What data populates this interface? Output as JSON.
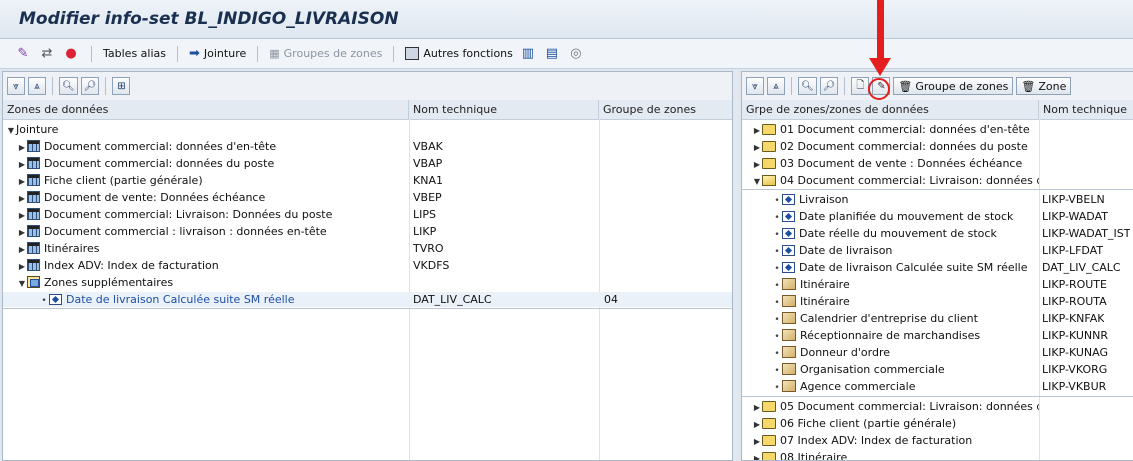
{
  "title": "Modifier info-set BL_INDIGO_LIVRAISON",
  "menubar": {
    "tables_alias": "Tables alias",
    "jointure": "Jointure",
    "groupes_de_zones": "Groupes de zones",
    "autres_fonctions": "Autres fonctions"
  },
  "left": {
    "headers": [
      "Zones de données",
      "Nom technique",
      "Groupe de zones"
    ],
    "root": "Jointure",
    "tables": [
      {
        "label": "Document commercial: données d'en-tête",
        "tech": "VBAK"
      },
      {
        "label": "Document commercial: données du poste",
        "tech": "VBAP"
      },
      {
        "label": "Fiche client (partie générale)",
        "tech": "KNA1"
      },
      {
        "label": "Document de vente: Données échéance",
        "tech": "VBEP"
      },
      {
        "label": "Document commercial: Livraison: Données du poste",
        "tech": "LIPS"
      },
      {
        "label": "Document commercial : livraison : données en-tête",
        "tech": "LIKP"
      },
      {
        "label": "Itinéraires",
        "tech": "TVRO"
      },
      {
        "label": "Index ADV: Index de facturation",
        "tech": "VKDFS"
      }
    ],
    "extra_group": "Zones supplémentaires",
    "extra_field": {
      "label": "Date de livraison Calculée suite SM réelle",
      "tech": "DAT_LIV_CALC",
      "group": "04"
    }
  },
  "right": {
    "toolbar": {
      "groupes_btn": "Groupe de zones",
      "zone_btn": "Zone"
    },
    "headers": [
      "Grpe de zones/zones de données",
      "Nom technique"
    ],
    "groups_before": [
      "01 Document commercial: données d'en-tête",
      "02 Document commercial: données du poste",
      "03 Document de vente : Données échéance"
    ],
    "open_group": "04 Document commercial: Livraison: données d",
    "fields": [
      {
        "label": "Livraison",
        "tech": "LIKP-VBELN",
        "kind": "field"
      },
      {
        "label": "Date planifiée du mouvement de stock",
        "tech": "LIKP-WADAT",
        "kind": "field"
      },
      {
        "label": "Date réelle du mouvement de stock",
        "tech": "LIKP-WADAT_IST",
        "kind": "field"
      },
      {
        "label": "Date de livraison",
        "tech": "LIKP-LFDAT",
        "kind": "field"
      },
      {
        "label": "Date de livraison Calculée suite SM réelle",
        "tech": "DAT_LIV_CALC",
        "kind": "field"
      },
      {
        "label": "Itinéraire",
        "tech": "LIKP-ROUTE",
        "kind": "struct"
      },
      {
        "label": "Itinéraire",
        "tech": "LIKP-ROUTA",
        "kind": "struct"
      },
      {
        "label": "Calendrier d'entreprise du client",
        "tech": "LIKP-KNFAK",
        "kind": "struct"
      },
      {
        "label": "Réceptionnaire de marchandises",
        "tech": "LIKP-KUNNR",
        "kind": "struct"
      },
      {
        "label": "Donneur d'ordre",
        "tech": "LIKP-KUNAG",
        "kind": "struct"
      },
      {
        "label": "Organisation commerciale",
        "tech": "LIKP-VKORG",
        "kind": "struct"
      },
      {
        "label": "Agence commerciale",
        "tech": "LIKP-VKBUR",
        "kind": "struct"
      }
    ],
    "groups_after": [
      "05 Document commercial: Livraison: données d",
      "06 Fiche client (partie générale)",
      "07 Index ADV: Index de facturation",
      "08 Itinéraire"
    ]
  }
}
